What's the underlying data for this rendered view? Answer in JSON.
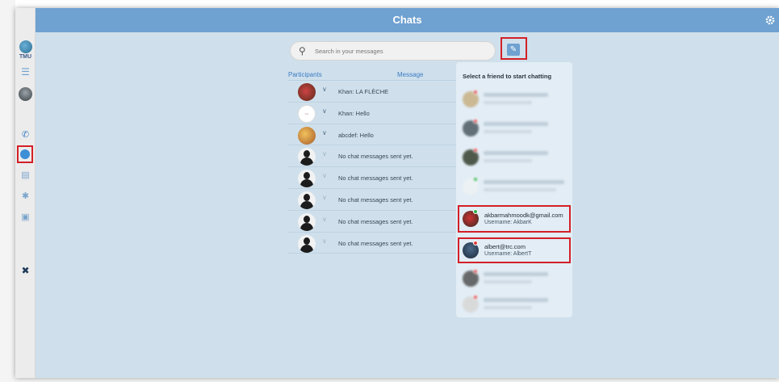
{
  "header": {
    "title": "Chats"
  },
  "sidebar": {
    "logo_text": "TMU"
  },
  "search": {
    "placeholder": "Search in your messages"
  },
  "table": {
    "headers": {
      "participants": "Participants",
      "message": "Message"
    },
    "rows": [
      {
        "message": "Khan: LA FLÈCHE"
      },
      {
        "message": "Khan: Hello"
      },
      {
        "message": "abcdef: Hello"
      },
      {
        "message": "No chat messages sent yet."
      },
      {
        "message": "No chat messages sent yet."
      },
      {
        "message": "No chat messages sent yet."
      },
      {
        "message": "No chat messages sent yet."
      },
      {
        "message": "No chat messages sent yet."
      }
    ]
  },
  "friends_panel": {
    "title": "Select a friend to start chatting",
    "visible_friends": [
      {
        "email": "akbarmahmoodk@gmail.com",
        "username": "Username: AkbarK"
      },
      {
        "email": "albert@trc.com",
        "username": "Username: AlbertT"
      }
    ]
  },
  "colors": {
    "accent": "#6fa1d1",
    "highlight": "#d32027",
    "online": "#2fb34a",
    "offline": "#e04040"
  }
}
